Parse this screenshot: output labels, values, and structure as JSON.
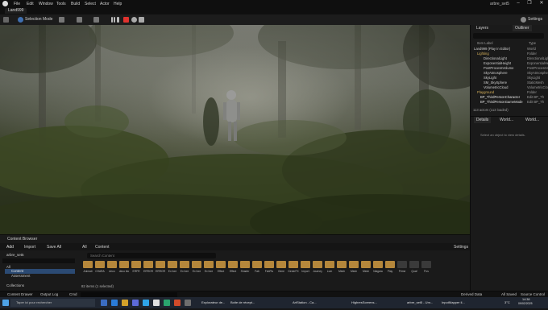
{
  "menubar": {
    "items": [
      "File",
      "Edit",
      "Window",
      "Tools",
      "Build",
      "Select",
      "Actor",
      "Help"
    ],
    "project_name": "arbre_set5",
    "controls": [
      "–",
      "❐",
      "✕"
    ]
  },
  "level_tab": {
    "label": "Land999"
  },
  "toolbar": {
    "selection_mode": "Selection Mode",
    "settings": "Settings"
  },
  "outliner": {
    "tab_layers": "Layers",
    "tab_outliner": "Outliner",
    "col_label": "Item Label",
    "col_type": "Type",
    "rows": [
      {
        "name": "Land999 (Play In Editor)",
        "type": "World",
        "color": "#d0d0d0",
        "indent": 4
      },
      {
        "name": "Lighting",
        "type": "Folder",
        "color": "#d6b05a",
        "indent": 8
      },
      {
        "name": "DirectionalLight",
        "type": "DirectionalLight",
        "color": "#d0d0d0",
        "indent": 16
      },
      {
        "name": "ExponentialHeight",
        "type": "ExponentialHeight",
        "color": "#d0d0d0",
        "indent": 16
      },
      {
        "name": "PostProcessVolume",
        "type": "PostProcessVolume",
        "color": "#d0d0d0",
        "indent": 16
      },
      {
        "name": "SkyAtmosphere",
        "type": "SkyAtmosphere",
        "color": "#d0d0d0",
        "indent": 16
      },
      {
        "name": "SkyLight",
        "type": "SkyLight",
        "color": "#d0d0d0",
        "indent": 16
      },
      {
        "name": "SM_SkySphere",
        "type": "StaticMesh",
        "color": "#d0d0d0",
        "indent": 16
      },
      {
        "name": "VolumetricCloud",
        "type": "VolumetricCloud",
        "color": "#d0d0d0",
        "indent": 16
      },
      {
        "name": "Playground",
        "type": "Folder",
        "color": "#d6b05a",
        "indent": 8
      },
      {
        "name": "BP_ThirdPersonCharacter",
        "type": "Edit BP_Th",
        "color": "#e0e0e0",
        "indent": 12
      },
      {
        "name": "BP_ThirdPersonGameMode",
        "type": "Edit BP_Th",
        "color": "#e0e0e0",
        "indent": 12
      }
    ],
    "footer": "113 actors (113 loaded)"
  },
  "details": {
    "tab_details": "Details",
    "tab_world1": "World...",
    "tab_world2": "World...",
    "empty_msg": "Select an object to view details."
  },
  "content_browser": {
    "tab": "Content Browser",
    "add": "Add",
    "import": "Import",
    "save_all": "Save All",
    "path_all": "All",
    "path_content": "Content",
    "settings": "Settings",
    "search_placeholder": "Search Content",
    "tree_root": "arbre_set5",
    "tree_all": "All",
    "tree_content": "Content",
    "tree_sub": "Assessment",
    "collections": "Collections",
    "item_count": "82 items (1 selected)",
    "assets": [
      "Animati",
      "CHARA",
      "deco",
      "deco bio",
      "ERFR",
      "ERROR",
      "ERROR",
      "Ex fore",
      "Ex fore",
      "Ex fore",
      "Ex fore",
      "Effect",
      "Effect",
      "Shader",
      "Fab",
      "FabPlu",
      "Gene",
      "GenerFX",
      "Import",
      "Journey",
      "Lum",
      "Mesh",
      "Mesh",
      "Mesh",
      "Niagara",
      "Play",
      "Prime",
      "Quaf",
      "Pos"
    ]
  },
  "statusbar": {
    "content_drawer": "Content Drawer",
    "output_log": "Output Log",
    "cmd": "Cmd",
    "console_placeholder": "Enter Console Command",
    "derived_data": "Derived Data",
    "all_saved": "All Saved",
    "source_control": "Source Control"
  },
  "taskbar": {
    "search_placeholder": "Taper ici pour rechercher",
    "apps": [
      "Explorateur de...",
      "Boite de récept...",
      "ArtStation - Ca...",
      "HighresScreens...",
      "arbre_set5 - Unr...",
      "InputMapper il..."
    ],
    "temp": "3°C",
    "time": "14:38",
    "date": "09/02/2025"
  }
}
